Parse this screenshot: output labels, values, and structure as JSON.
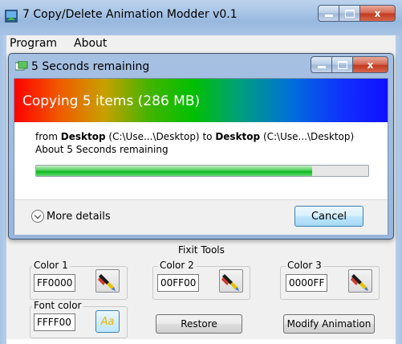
{
  "window": {
    "title": "7 Copy/Delete Animation Modder v0.1",
    "caption_min": "",
    "caption_max": "",
    "caption_close": "x"
  },
  "menu": {
    "items": [
      "Program",
      "About"
    ]
  },
  "dialog": {
    "title": "5 Seconds remaining",
    "heading": "Copying 5 items (286 MB)",
    "from_label": "from",
    "from_name": "Desktop",
    "from_path": "(C:\\Use...\\Desktop)",
    "to_label": "to",
    "to_name": "Desktop",
    "to_path": "(C:\\Use...\\Desktop)",
    "remaining": "About 5 Seconds remaining",
    "progress_fraction": 0.83,
    "more_details": "More details",
    "cancel": "Cancel",
    "caption_close": "x"
  },
  "tools": {
    "title": "Fixit Tools",
    "color1": {
      "label": "Color 1",
      "value": "FF0000"
    },
    "color2": {
      "label": "Color 2",
      "value": "00FF00"
    },
    "color3": {
      "label": "Color 3",
      "value": "0000FF"
    },
    "font_color": {
      "label": "Font color",
      "value": "FFFF00"
    },
    "font_button": "Aa",
    "restore": "Restore",
    "modify": "Modify Animation"
  },
  "colors": {
    "gradient_start": "#ff0000",
    "gradient_mid": "#00c000",
    "gradient_end": "#1010ff",
    "font_color": "#e8b800",
    "progress_green": "#0fb91f"
  }
}
